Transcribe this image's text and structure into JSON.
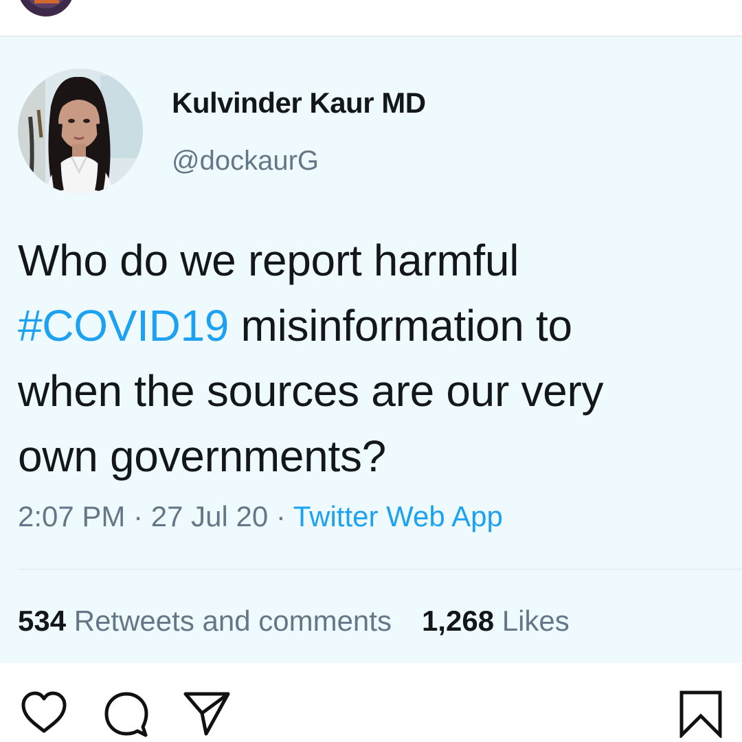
{
  "tweet": {
    "display_name": "Kulvinder Kaur MD",
    "handle": "@dockaurG",
    "text_line1": "Who do we report harmful",
    "hashtag": "#COVID19",
    "text_after_hashtag": " misinformation to",
    "text_line3": "when the sources are our very",
    "text_line4": "own governments?",
    "time": "2:07 PM",
    "separator": " · ",
    "date": "27 Jul 20",
    "source": "Twitter Web App",
    "retweets_count": "534",
    "retweets_label": " Retweets and comments",
    "likes_count": "1,268",
    "likes_label": " Likes"
  },
  "actions": {
    "like_icon": "heart-icon",
    "comment_icon": "comment-icon",
    "share_icon": "paper-plane-icon",
    "save_icon": "bookmark-icon"
  },
  "colors": {
    "tweet_background": "#eefafd",
    "hashtag_link": "#1da1f2",
    "secondary_text": "#657786",
    "primary_text": "#14171a"
  }
}
